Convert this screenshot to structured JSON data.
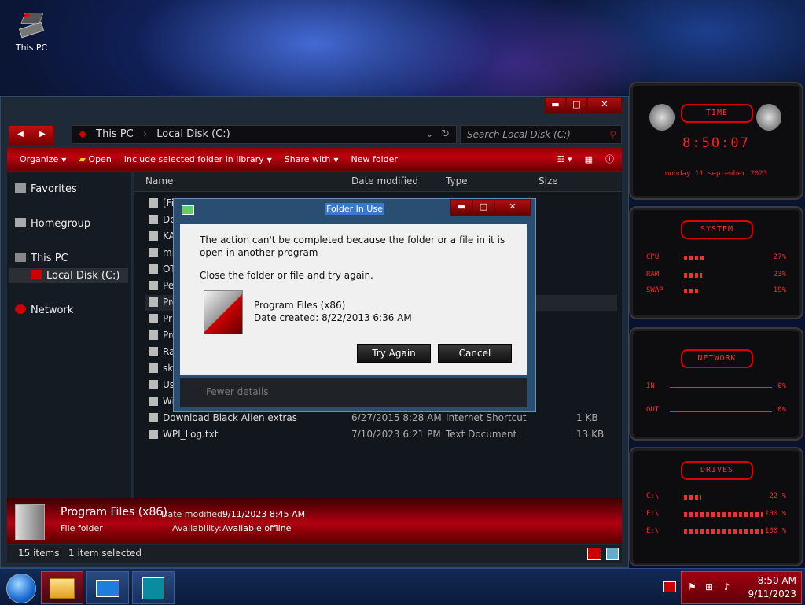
{
  "desktop": {
    "icon_label": "This PC"
  },
  "explorer": {
    "title_buttons": {
      "minimize": "▬",
      "maximize": "□",
      "close": "✕"
    },
    "nav": {
      "back": "◀",
      "forward": "▶"
    },
    "address": {
      "crumb1": "This PC",
      "crumb2": "Local Disk (C:)"
    },
    "search_placeholder": "Search Local Disk (C:)",
    "toolbar": {
      "organize": "Organize",
      "open": "Open",
      "include": "Include selected folder in library",
      "share": "Share with",
      "new_folder": "New folder"
    },
    "sidebar": {
      "favorites": "Favorites",
      "homegroup": "Homegroup",
      "this_pc": "This PC",
      "local_disk": "Local Disk (C:)",
      "network": "Network"
    },
    "columns": {
      "name": "Name",
      "date": "Date modified",
      "type": "Type",
      "size": "Size"
    },
    "rows": [
      {
        "name": "[Fi"
      },
      {
        "name": "Do"
      },
      {
        "name": "KA"
      },
      {
        "name": "mi"
      },
      {
        "name": "OT"
      },
      {
        "name": "Pe"
      },
      {
        "name": "Pro"
      },
      {
        "name": "Pr"
      },
      {
        "name": "Pro"
      },
      {
        "name": "Ra"
      },
      {
        "name": "ski"
      },
      {
        "name": "Us"
      },
      {
        "name": "Wi"
      },
      {
        "name": "Download Black Alien extras",
        "date": "6/27/2015 8:28 AM",
        "type": "Internet Shortcut",
        "size": "1 KB"
      },
      {
        "name": "WPI_Log.txt",
        "date": "7/10/2023 6:21 PM",
        "type": "Text Document",
        "size": "13 KB"
      }
    ],
    "details": {
      "name": "Program Files (x86)",
      "kind": "File folder",
      "date_label": "Date modified:",
      "date_value": "9/11/2023 8:45 AM",
      "avail_label": "Availability:",
      "avail_value": "Available offline"
    },
    "status": {
      "count": "15 items",
      "selected": "1 item selected"
    }
  },
  "dialog": {
    "title": "Folder In Use",
    "message": "The action can't be completed because the folder or a file in it is open in another program",
    "instruction": "Close the folder or file and try again.",
    "file_name": "Program Files (x86)",
    "file_created": "Date created: 8/22/2013 6:36 AM",
    "try_again": "Try Again",
    "cancel": "Cancel",
    "fewer_details": "Fewer details"
  },
  "gadgets": {
    "time": {
      "title": "TIME",
      "clock": "8:50:07",
      "date": "monday 11 september 2023"
    },
    "system": {
      "title": "SYSTEM",
      "rows": [
        {
          "label": "CPU",
          "value": "27%",
          "fill": 0.27
        },
        {
          "label": "RAM",
          "value": "23%",
          "fill": 0.23
        },
        {
          "label": "SWAP",
          "value": "19%",
          "fill": 0.19
        }
      ]
    },
    "network": {
      "title": "NETWORK",
      "rows": [
        {
          "label": "IN",
          "value": "0%"
        },
        {
          "label": "OUT",
          "value": "0%"
        }
      ]
    },
    "drives": {
      "title": "DRIVES",
      "rows": [
        {
          "label": "C:\\",
          "value": "22 %",
          "fill": 0.22
        },
        {
          "label": "F:\\",
          "value": "100 %",
          "fill": 1.0
        },
        {
          "label": "E:\\",
          "value": "100 %",
          "fill": 1.0
        }
      ]
    }
  },
  "taskbar": {
    "time": "8:50 AM",
    "date": "9/11/2023"
  },
  "colors": {
    "accent": "#c00010",
    "dialog_frame": "#2a4e72",
    "gadget_red": "#ff2a2a"
  }
}
